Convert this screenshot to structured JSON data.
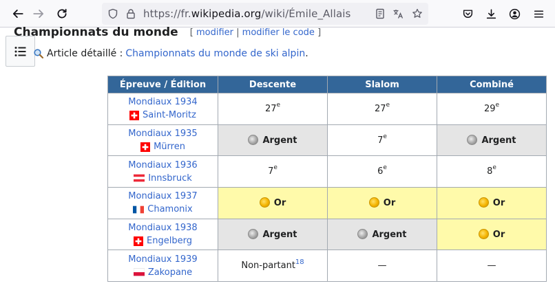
{
  "browser": {
    "url_prefix": "https://fr.",
    "url_domain": "wikipedia.org",
    "url_path": "/wiki/Émile_Allais"
  },
  "page": {
    "heading": "Championnats du monde",
    "edit_open": "[",
    "edit_link": "modifier",
    "edit_sep": "|",
    "edit_code_link": "modifier le code",
    "edit_close": "]",
    "main_article_label": "Article détaillé :",
    "main_article_link": "Championnats du monde de ski alpin",
    "main_article_period": "."
  },
  "table": {
    "headers": [
      "Épreuve / Édition",
      "Descente",
      "Slalom",
      "Combiné"
    ],
    "rows": [
      {
        "edition": "Mondiaux 1934",
        "place": "Saint-Moritz",
        "flag": "switzerland",
        "descente": {
          "rank": "27",
          "sup": "e"
        },
        "slalom": {
          "rank": "27",
          "sup": "e"
        },
        "combine": {
          "rank": "29",
          "sup": "e"
        }
      },
      {
        "edition": "Mondiaux 1935",
        "place": "Mürren",
        "flag": "switzerland",
        "descente": {
          "medal": "Argent"
        },
        "slalom": {
          "rank": "7",
          "sup": "e"
        },
        "combine": {
          "medal": "Argent"
        }
      },
      {
        "edition": "Mondiaux 1936",
        "place": "Innsbruck",
        "flag": "austria",
        "descente": {
          "rank": "7",
          "sup": "e"
        },
        "slalom": {
          "rank": "6",
          "sup": "e"
        },
        "combine": {
          "rank": "8",
          "sup": "e"
        }
      },
      {
        "edition": "Mondiaux 1937",
        "place": "Chamonix",
        "flag": "france",
        "descente": {
          "medal": "Or"
        },
        "slalom": {
          "medal": "Or"
        },
        "combine": {
          "medal": "Or"
        }
      },
      {
        "edition": "Mondiaux 1938",
        "place": "Engelberg",
        "flag": "switzerland",
        "descente": {
          "medal": "Argent"
        },
        "slalom": {
          "medal": "Argent"
        },
        "combine": {
          "medal": "Or"
        }
      },
      {
        "edition": "Mondiaux 1939",
        "place": "Zakopane",
        "flag": "poland",
        "descente": {
          "text": "Non-partant",
          "ref": "18"
        },
        "slalom": {
          "text": "—"
        },
        "combine": {
          "text": "—"
        }
      }
    ]
  },
  "colors": {
    "header_bg": "#336699",
    "silver_bg": "#e5e5e5",
    "gold_bg": "#fffaaa",
    "link": "#3366cc"
  }
}
